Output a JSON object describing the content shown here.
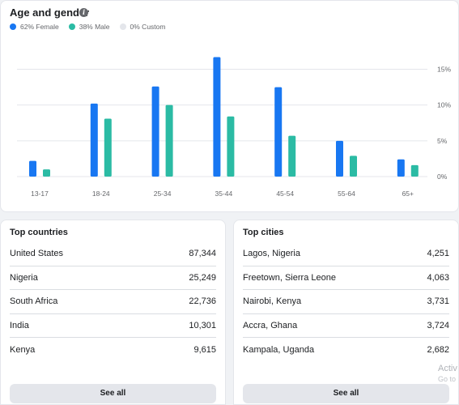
{
  "age_gender": {
    "title": "Age and gender",
    "info_icon": "info-icon",
    "legend": [
      {
        "label": "62% Female",
        "color": "#1877f2"
      },
      {
        "label": "38% Male",
        "color": "#2bbba4"
      },
      {
        "label": "0% Custom",
        "color": "#e4e6eb"
      }
    ]
  },
  "chart_data": {
    "type": "bar",
    "categories": [
      "13-17",
      "18-24",
      "25-34",
      "35-44",
      "45-54",
      "55-64",
      "65+"
    ],
    "series": [
      {
        "name": "Female",
        "color": "#1877f2",
        "values": [
          2.2,
          10.2,
          12.6,
          16.7,
          12.5,
          5.0,
          2.4
        ]
      },
      {
        "name": "Male",
        "color": "#2bbba4",
        "values": [
          1.0,
          8.1,
          10.0,
          8.4,
          5.7,
          2.9,
          1.6
        ]
      }
    ],
    "y_ticks": [
      "15%",
      "10%",
      "5%",
      "0%"
    ],
    "ylim": [
      0,
      18
    ],
    "grid": true
  },
  "top_countries": {
    "title": "Top countries",
    "rows": [
      {
        "name": "United States",
        "value": "87,344"
      },
      {
        "name": "Nigeria",
        "value": "25,249"
      },
      {
        "name": "South Africa",
        "value": "22,736"
      },
      {
        "name": "India",
        "value": "10,301"
      },
      {
        "name": "Kenya",
        "value": "9,615"
      }
    ],
    "see_all": "See all"
  },
  "top_cities": {
    "title": "Top cities",
    "rows": [
      {
        "name": "Lagos, Nigeria",
        "value": "4,251"
      },
      {
        "name": "Freetown, Sierra Leone",
        "value": "4,063"
      },
      {
        "name": "Nairobi, Kenya",
        "value": "3,731"
      },
      {
        "name": "Accra, Ghana",
        "value": "3,724"
      },
      {
        "name": "Kampala, Uganda",
        "value": "2,682"
      }
    ],
    "see_all": "See all"
  },
  "watermark": {
    "line1": "Activ",
    "line2": "Go to"
  }
}
